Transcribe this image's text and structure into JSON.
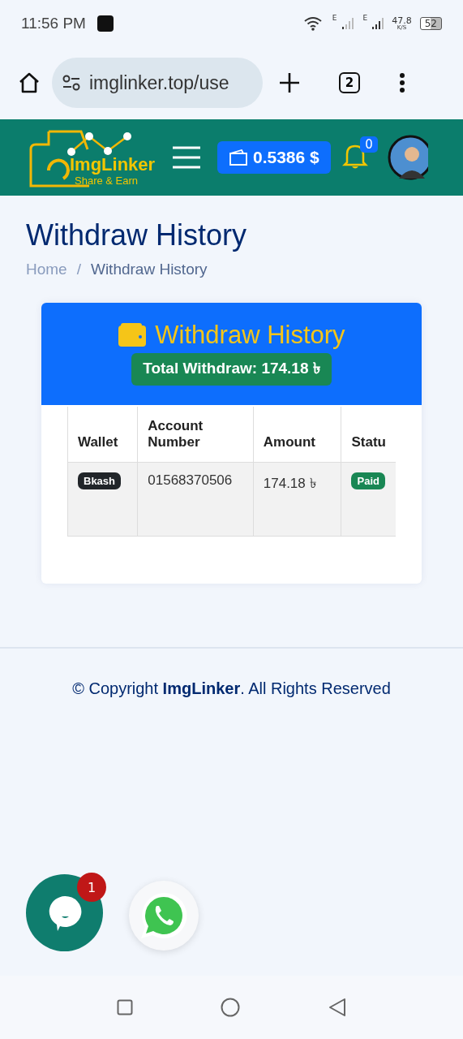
{
  "status_bar": {
    "time": "11:56 PM",
    "network_1": "E",
    "network_2": "E",
    "speed": "47.8",
    "speed_unit": "K/S",
    "battery": "52"
  },
  "browser": {
    "url": "imglinker.top/use",
    "tab_count": "2"
  },
  "header": {
    "logo_title": "ImgLinker",
    "logo_tagline": "Share & Earn",
    "balance": "0.5386 $",
    "notification_count": "0"
  },
  "page": {
    "title": "Withdraw History",
    "breadcrumb_separator": "/",
    "breadcrumb": [
      {
        "label": "Home",
        "current": false
      },
      {
        "label": "Withdraw History",
        "current": true
      }
    ]
  },
  "card": {
    "title": "Withdraw History",
    "total": "Total Withdraw: 174.18 ৳"
  },
  "table": {
    "columns": [
      "Wallet",
      "Account Number",
      "Amount",
      "Statu"
    ],
    "rows": [
      {
        "wallet": "Bkash",
        "account": "01568370506",
        "amount": "174.18 ৳",
        "status": "Paid"
      }
    ]
  },
  "footer": {
    "copyright": "© Copyright **ImgLinker**. All Rights Reserved"
  },
  "chat": {
    "badge": "1"
  }
}
